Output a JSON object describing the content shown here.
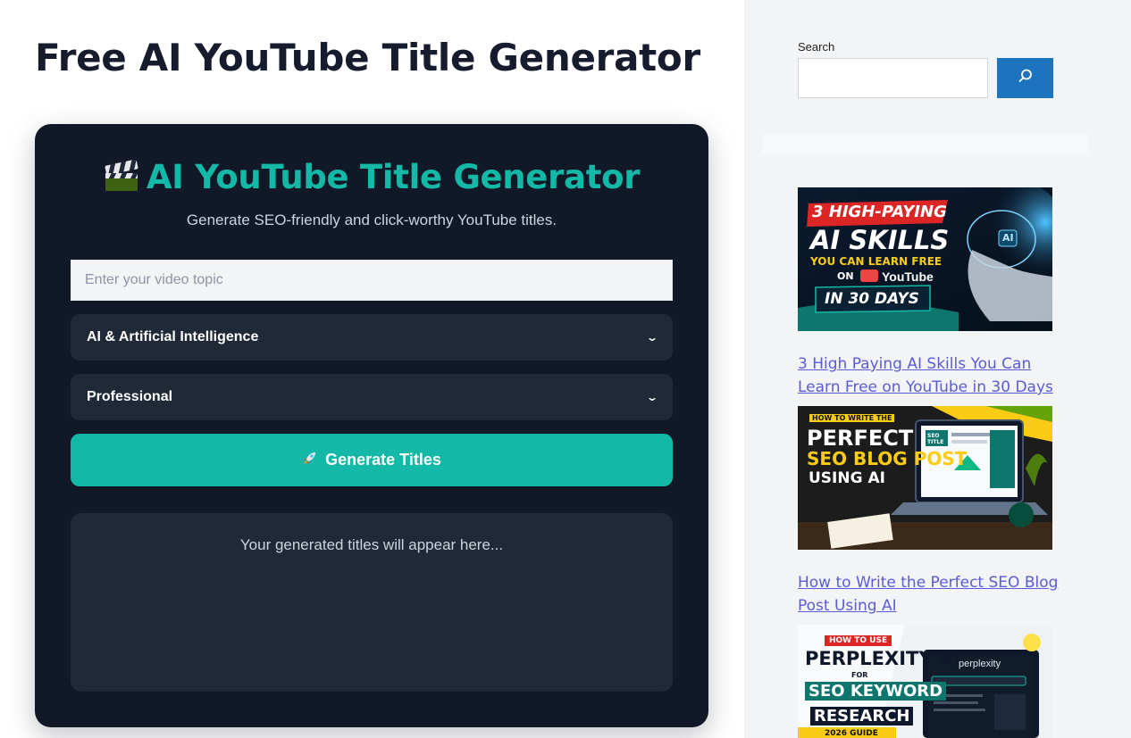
{
  "page": {
    "title": "Free AI YouTube Title Generator"
  },
  "tool": {
    "emoji_icon": "clapper-board",
    "heading": "AI YouTube Title Generator",
    "subheading": "Generate SEO-friendly and click-worthy YouTube titles.",
    "topic_input": {
      "value": "",
      "placeholder": "Enter your video topic"
    },
    "category_select": {
      "selected": "AI & Artificial Intelligence"
    },
    "tone_select": {
      "selected": "Professional"
    },
    "generate_button": {
      "icon": "rocket-icon",
      "label": "Generate Titles"
    },
    "output_placeholder": "Your generated titles will appear here..."
  },
  "sidebar": {
    "search": {
      "label": "Search",
      "value": "",
      "button_icon": "search-icon"
    },
    "posts": [
      {
        "title": "3 High Paying AI Skills You Can Learn Free on YouTube in 30 Days",
        "thumb_lines": [
          "3 HIGH-PAYING",
          "AI SKILLS",
          "YOU CAN LEARN FREE",
          "ON",
          "YouTube",
          "IN 30 DAYS",
          "AI"
        ]
      },
      {
        "title": "How to Write the Perfect SEO Blog Post Using AI",
        "thumb_lines": [
          "HOW TO WRITE THE",
          "PERFECT",
          "SEO BLOG POST",
          "USING AI",
          "SEO TITLE"
        ]
      },
      {
        "title": "",
        "thumb_lines": [
          "HOW TO USE",
          "PERPLEXITY AI",
          "FOR",
          "SEO KEYWORD",
          "RESEARCH",
          "perplexity",
          "2026 GUIDE"
        ]
      }
    ]
  },
  "colors": {
    "accent": "#14b8a6",
    "tool_bg": "#111827",
    "field_bg": "#1f2937",
    "search_button": "#1e73be",
    "link": "#5b5bd6",
    "sidebar_bg": "#f3f4f6"
  }
}
